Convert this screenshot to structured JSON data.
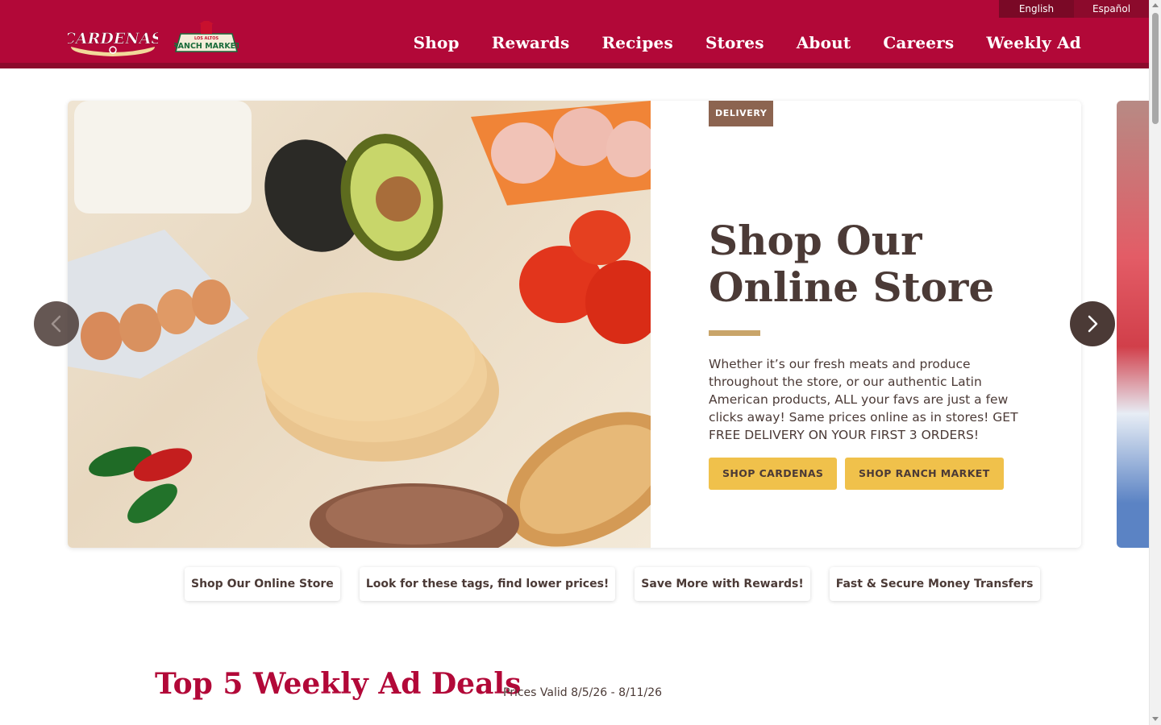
{
  "language": {
    "options": [
      "English",
      "Español"
    ],
    "selected": "English"
  },
  "logos": {
    "cardenas": "CARDENAS",
    "ranch_market_top": "LOS ALTOS",
    "ranch_market": "RANCH MARKET"
  },
  "nav": {
    "items": [
      "Shop",
      "Rewards",
      "Recipes",
      "Stores",
      "About",
      "Careers",
      "Weekly Ad"
    ]
  },
  "hero": {
    "badge": "DELIVERY",
    "title": "Shop Our Online Store",
    "description": "Whether it’s our fresh meats and produce throughout the store, or our authentic Latin American products, ALL your favs are just a few clicks away! Same prices online as in stores! GET FREE DELIVERY ON YOUR FIRST 3 ORDERS!",
    "buttons": [
      "SHOP CARDENAS",
      "SHOP RANCH MARKET"
    ]
  },
  "carousel_tabs": [
    "Shop Our Online Store",
    "Look for these tags, find lower prices!",
    "Save More with Rewards!",
    "Fast & Secure Money Transfers"
  ],
  "deals": {
    "title": "Top 5 Weekly Ad Deals",
    "valid": "Prices Valid 8/5/26 - 8/11/26"
  },
  "colors": {
    "brand_red": "#b20838",
    "brown_text": "#4b3a36",
    "button_yellow": "#f0c14b",
    "badge_brown": "#8c6450",
    "rule_gold": "#c9a56a"
  },
  "icons": [
    "chevron-left-icon",
    "chevron-right-icon"
  ]
}
